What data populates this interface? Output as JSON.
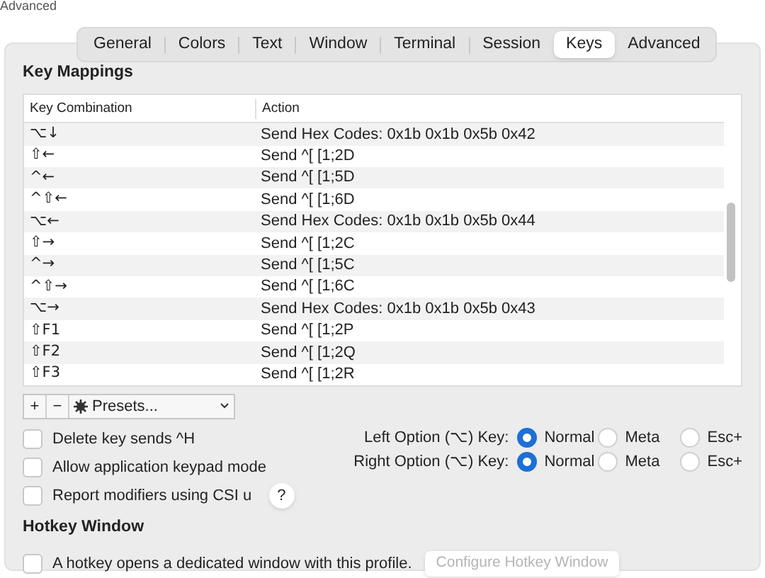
{
  "window": {
    "title": "Advanced"
  },
  "tabs": [
    {
      "label": "General",
      "selected": false
    },
    {
      "label": "Colors",
      "selected": false
    },
    {
      "label": "Text",
      "selected": false
    },
    {
      "label": "Window",
      "selected": false
    },
    {
      "label": "Terminal",
      "selected": false
    },
    {
      "label": "Session",
      "selected": false
    },
    {
      "label": "Keys",
      "selected": true
    },
    {
      "label": "Advanced",
      "selected": false
    }
  ],
  "key_mappings": {
    "title": "Key Mappings",
    "columns": [
      "Key Combination",
      "Action"
    ],
    "rows": [
      [
        "⌥↓",
        "Send Hex Codes: 0x1b 0x1b 0x5b 0x42"
      ],
      [
        "⇧←",
        "Send ^[ [1;2D"
      ],
      [
        "^←",
        "Send ^[ [1;5D"
      ],
      [
        "^⇧←",
        "Send ^[ [1;6D"
      ],
      [
        "⌥←",
        "Send Hex Codes: 0x1b 0x1b 0x5b 0x44"
      ],
      [
        "⇧→",
        "Send ^[ [1;2C"
      ],
      [
        "^→",
        "Send ^[ [1;5C"
      ],
      [
        "^⇧→",
        "Send ^[ [1;6C"
      ],
      [
        "⌥→",
        "Send Hex Codes: 0x1b 0x1b 0x5b 0x43"
      ],
      [
        "⇧F1",
        "Send ^[ [1;2P"
      ],
      [
        "⇧F2",
        "Send ^[ [1;2Q"
      ],
      [
        "⇧F3",
        "Send ^[ [1;2R"
      ]
    ],
    "add": "+",
    "remove": "−",
    "presets": "Presets..."
  },
  "options": [
    {
      "label": "Delete key sends ^H",
      "checked": false
    },
    {
      "label": "Allow application keypad mode",
      "checked": false
    },
    {
      "label": "Report modifiers using CSI u",
      "checked": false,
      "help": "?"
    }
  ],
  "option_keys": [
    {
      "label": "Left Option (⌥) Key:",
      "choices": [
        {
          "label": "Normal",
          "selected": true
        },
        {
          "label": "Meta",
          "selected": false
        },
        {
          "label": "Esc+",
          "selected": false
        }
      ]
    },
    {
      "label": "Right Option (⌥) Key:",
      "choices": [
        {
          "label": "Normal",
          "selected": true
        },
        {
          "label": "Meta",
          "selected": false
        },
        {
          "label": "Esc+",
          "selected": false
        }
      ]
    }
  ],
  "hotkey": {
    "title": "Hotkey Window",
    "option": {
      "label": "A hotkey opens a dedicated window with this profile.",
      "checked": false
    },
    "button": {
      "label": "Configure Hotkey Window",
      "disabled": true
    }
  }
}
